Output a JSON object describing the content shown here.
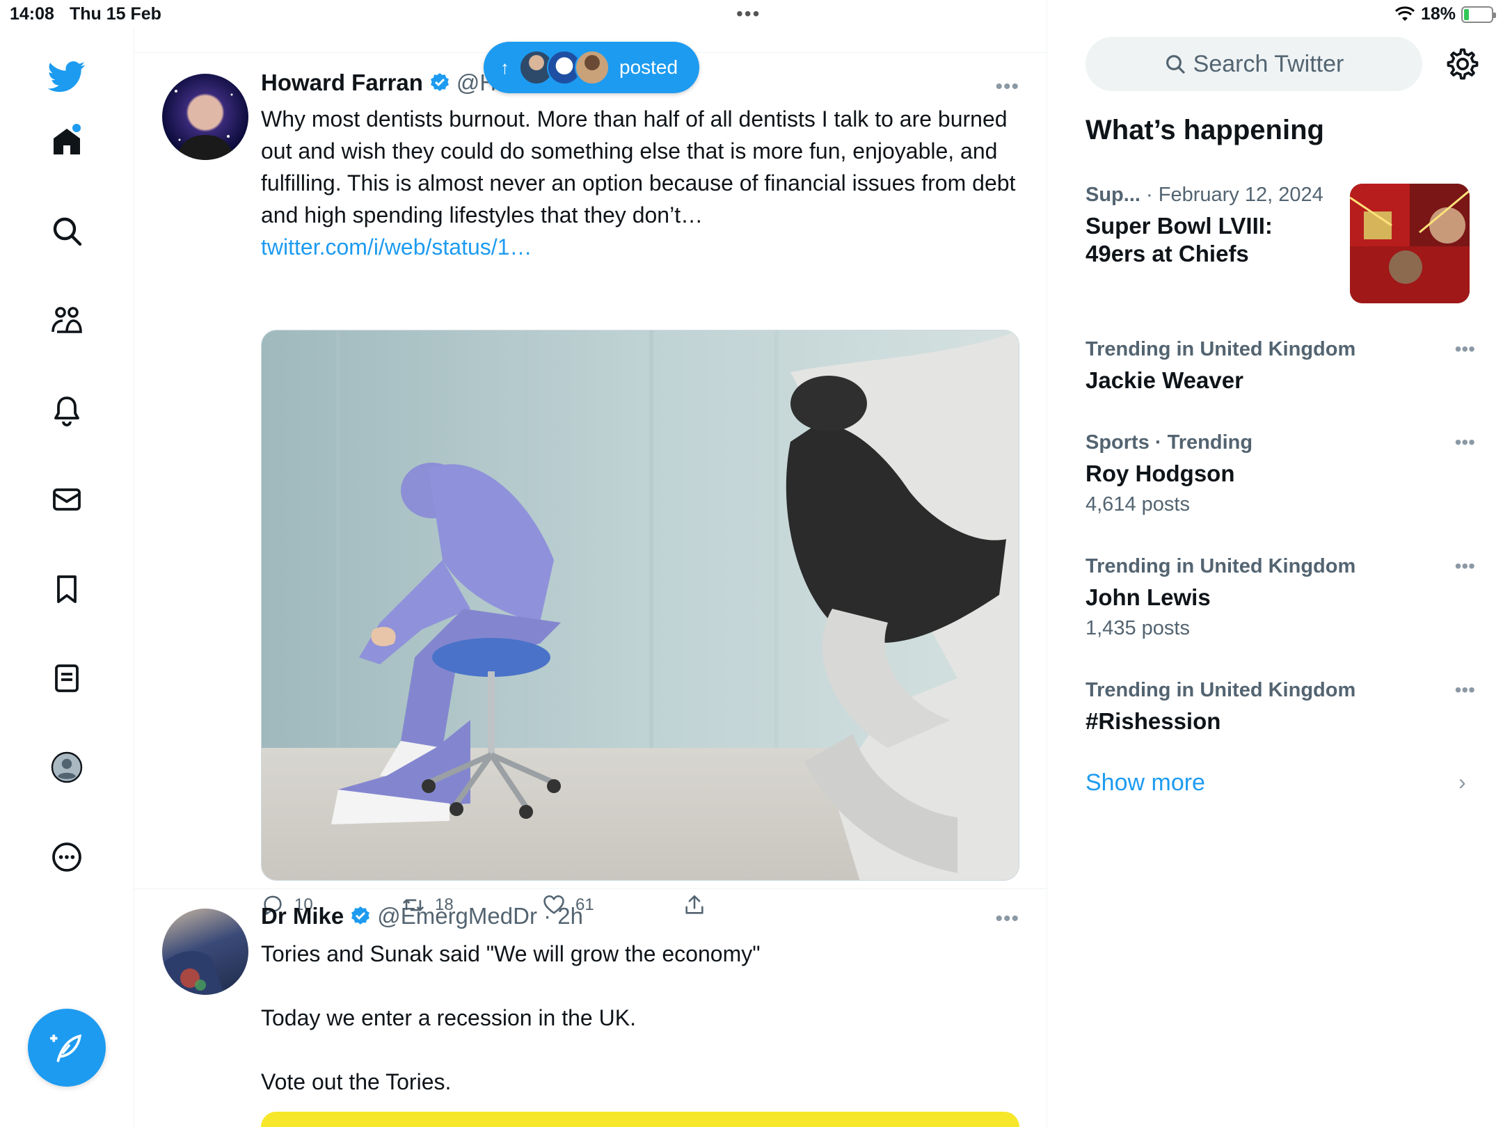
{
  "status_bar": {
    "time": "14:08",
    "date": "Thu 15 Feb",
    "battery": "18%",
    "battery_level": 0.18
  },
  "nav": {
    "items": [
      "twitter-logo",
      "home",
      "explore",
      "communities",
      "notifications",
      "messages",
      "bookmarks",
      "lists",
      "profile",
      "more"
    ],
    "has_new_home_dot": true
  },
  "posted_pill": {
    "label": "posted",
    "arrow": "↑"
  },
  "tweets": [
    {
      "name": "Howard Farran",
      "handle": "@H",
      "text": "Why most dentists burnout. More than half of all dentists I talk to are burned out and wish they could do something else that is more fun, enjoyable, and fulfilling. This is almost never an option because of financial issues from debt and high spending lifestyles that they don’t…",
      "link": "twitter.com/i/web/status/1…",
      "replies": "10",
      "retweets": "18",
      "likes": "61"
    },
    {
      "name": "Dr Mike",
      "handle": "@EmergMedDr · 2h",
      "line1": "Tories and Sunak said \"We will grow the economy\"",
      "line2": "Today we enter a recession in the UK.",
      "line3": "Vote out the Tories."
    }
  ],
  "sidebar": {
    "search_placeholder": "Search Twitter",
    "heading": "What’s happening",
    "featured": {
      "category": "Sup...",
      "date": "· February 12, 2024",
      "title_line1": "Super Bowl LVIII:",
      "title_line2": "49ers at Chiefs"
    },
    "trends": [
      {
        "meta": "Trending in United Kingdom",
        "title": "Jackie Weaver",
        "count": ""
      },
      {
        "meta": "Sports · Trending",
        "title": "Roy Hodgson",
        "count": "4,614 posts"
      },
      {
        "meta": "Trending in United Kingdom",
        "title": "John Lewis",
        "count": "1,435 posts"
      },
      {
        "meta": "Trending in United Kingdom",
        "title": "#Rishession",
        "count": ""
      }
    ],
    "show_more": "Show more"
  },
  "colors": {
    "accent": "#1d9bf0",
    "text": "#0f1419",
    "secondary": "#536471",
    "border": "#eff3f4"
  }
}
